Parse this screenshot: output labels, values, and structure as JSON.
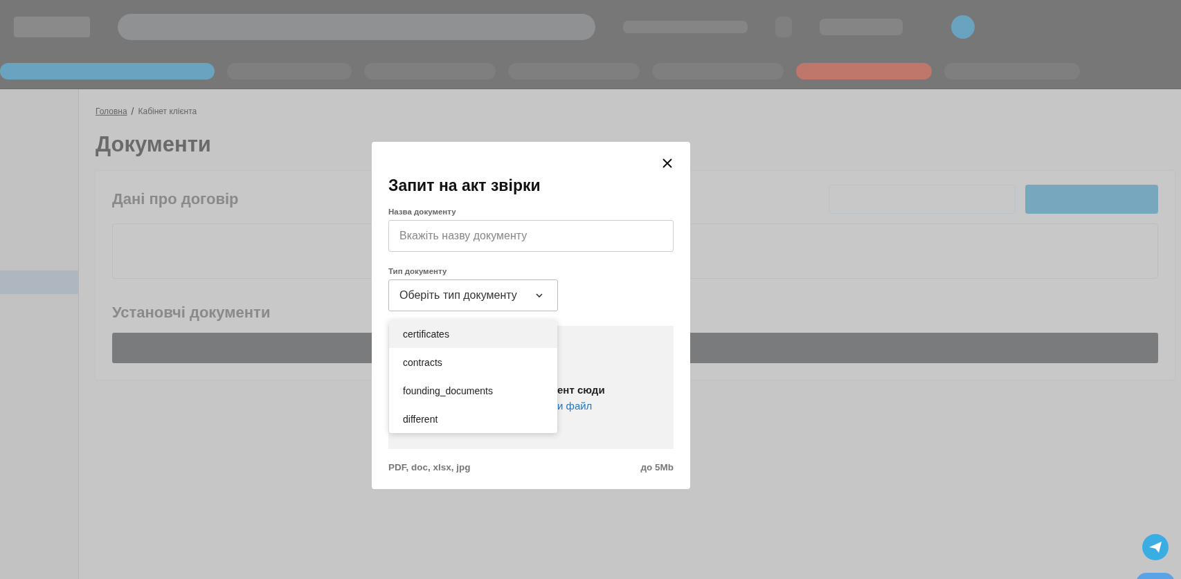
{
  "breadcrumb_separator": "/",
  "breadcrumb": [
    {
      "label": "Головна",
      "link": true
    },
    {
      "label": "Кабінет клієнта",
      "link": false
    }
  ],
  "page_title": "Документи",
  "sections": [
    "Дані про договір",
    "Установчі документи"
  ],
  "modal": {
    "title": "Запит на акт звірки",
    "name_field": {
      "label": "Назва документу",
      "placeholder": "Вкажіть назву документу"
    },
    "type_field": {
      "label": "Тип документу",
      "placeholder": "Оберіть тип документу",
      "expanded": true
    },
    "options": [
      {
        "label": "certificates",
        "selected": true
      },
      {
        "label": "contracts",
        "selected": false
      },
      {
        "label": "founding_documents",
        "selected": false
      },
      {
        "label": "different",
        "selected": false
      }
    ],
    "dropzone": {
      "text": "ент сюди",
      "link": "и файл"
    },
    "formats": "PDF, doc, xlsx, jpg",
    "max_size": "до 5Mb"
  }
}
